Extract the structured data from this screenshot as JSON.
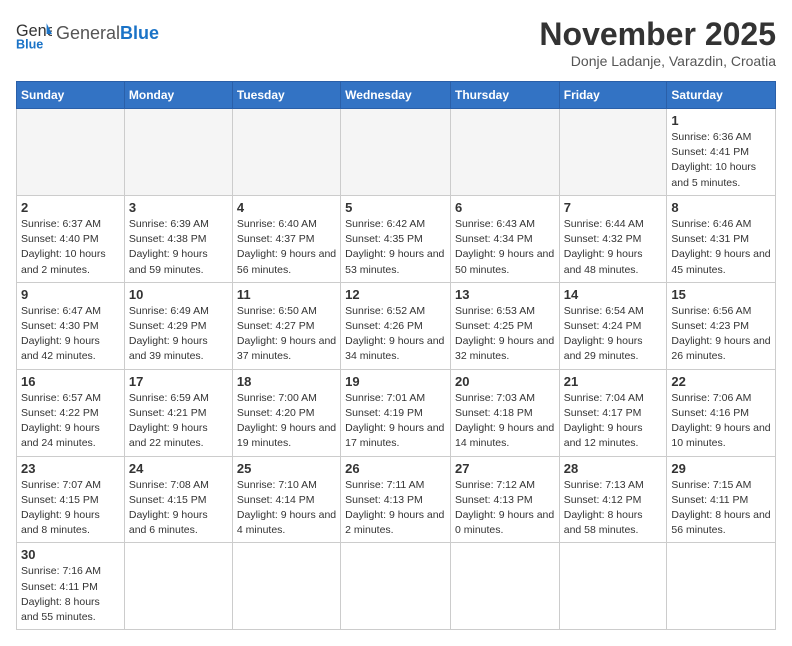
{
  "header": {
    "logo_general": "General",
    "logo_blue": "Blue",
    "month_title": "November 2025",
    "location": "Donje Ladanje, Varazdin, Croatia"
  },
  "weekdays": [
    "Sunday",
    "Monday",
    "Tuesday",
    "Wednesday",
    "Thursday",
    "Friday",
    "Saturday"
  ],
  "days": {
    "1": {
      "sunrise": "6:36 AM",
      "sunset": "4:41 PM",
      "daylight": "10 hours and 5 minutes."
    },
    "2": {
      "sunrise": "6:37 AM",
      "sunset": "4:40 PM",
      "daylight": "10 hours and 2 minutes."
    },
    "3": {
      "sunrise": "6:39 AM",
      "sunset": "4:38 PM",
      "daylight": "9 hours and 59 minutes."
    },
    "4": {
      "sunrise": "6:40 AM",
      "sunset": "4:37 PM",
      "daylight": "9 hours and 56 minutes."
    },
    "5": {
      "sunrise": "6:42 AM",
      "sunset": "4:35 PM",
      "daylight": "9 hours and 53 minutes."
    },
    "6": {
      "sunrise": "6:43 AM",
      "sunset": "4:34 PM",
      "daylight": "9 hours and 50 minutes."
    },
    "7": {
      "sunrise": "6:44 AM",
      "sunset": "4:32 PM",
      "daylight": "9 hours and 48 minutes."
    },
    "8": {
      "sunrise": "6:46 AM",
      "sunset": "4:31 PM",
      "daylight": "9 hours and 45 minutes."
    },
    "9": {
      "sunrise": "6:47 AM",
      "sunset": "4:30 PM",
      "daylight": "9 hours and 42 minutes."
    },
    "10": {
      "sunrise": "6:49 AM",
      "sunset": "4:29 PM",
      "daylight": "9 hours and 39 minutes."
    },
    "11": {
      "sunrise": "6:50 AM",
      "sunset": "4:27 PM",
      "daylight": "9 hours and 37 minutes."
    },
    "12": {
      "sunrise": "6:52 AM",
      "sunset": "4:26 PM",
      "daylight": "9 hours and 34 minutes."
    },
    "13": {
      "sunrise": "6:53 AM",
      "sunset": "4:25 PM",
      "daylight": "9 hours and 32 minutes."
    },
    "14": {
      "sunrise": "6:54 AM",
      "sunset": "4:24 PM",
      "daylight": "9 hours and 29 minutes."
    },
    "15": {
      "sunrise": "6:56 AM",
      "sunset": "4:23 PM",
      "daylight": "9 hours and 26 minutes."
    },
    "16": {
      "sunrise": "6:57 AM",
      "sunset": "4:22 PM",
      "daylight": "9 hours and 24 minutes."
    },
    "17": {
      "sunrise": "6:59 AM",
      "sunset": "4:21 PM",
      "daylight": "9 hours and 22 minutes."
    },
    "18": {
      "sunrise": "7:00 AM",
      "sunset": "4:20 PM",
      "daylight": "9 hours and 19 minutes."
    },
    "19": {
      "sunrise": "7:01 AM",
      "sunset": "4:19 PM",
      "daylight": "9 hours and 17 minutes."
    },
    "20": {
      "sunrise": "7:03 AM",
      "sunset": "4:18 PM",
      "daylight": "9 hours and 14 minutes."
    },
    "21": {
      "sunrise": "7:04 AM",
      "sunset": "4:17 PM",
      "daylight": "9 hours and 12 minutes."
    },
    "22": {
      "sunrise": "7:06 AM",
      "sunset": "4:16 PM",
      "daylight": "9 hours and 10 minutes."
    },
    "23": {
      "sunrise": "7:07 AM",
      "sunset": "4:15 PM",
      "daylight": "9 hours and 8 minutes."
    },
    "24": {
      "sunrise": "7:08 AM",
      "sunset": "4:15 PM",
      "daylight": "9 hours and 6 minutes."
    },
    "25": {
      "sunrise": "7:10 AM",
      "sunset": "4:14 PM",
      "daylight": "9 hours and 4 minutes."
    },
    "26": {
      "sunrise": "7:11 AM",
      "sunset": "4:13 PM",
      "daylight": "9 hours and 2 minutes."
    },
    "27": {
      "sunrise": "7:12 AM",
      "sunset": "4:13 PM",
      "daylight": "9 hours and 0 minutes."
    },
    "28": {
      "sunrise": "7:13 AM",
      "sunset": "4:12 PM",
      "daylight": "8 hours and 58 minutes."
    },
    "29": {
      "sunrise": "7:15 AM",
      "sunset": "4:11 PM",
      "daylight": "8 hours and 56 minutes."
    },
    "30": {
      "sunrise": "7:16 AM",
      "sunset": "4:11 PM",
      "daylight": "8 hours and 55 minutes."
    }
  }
}
